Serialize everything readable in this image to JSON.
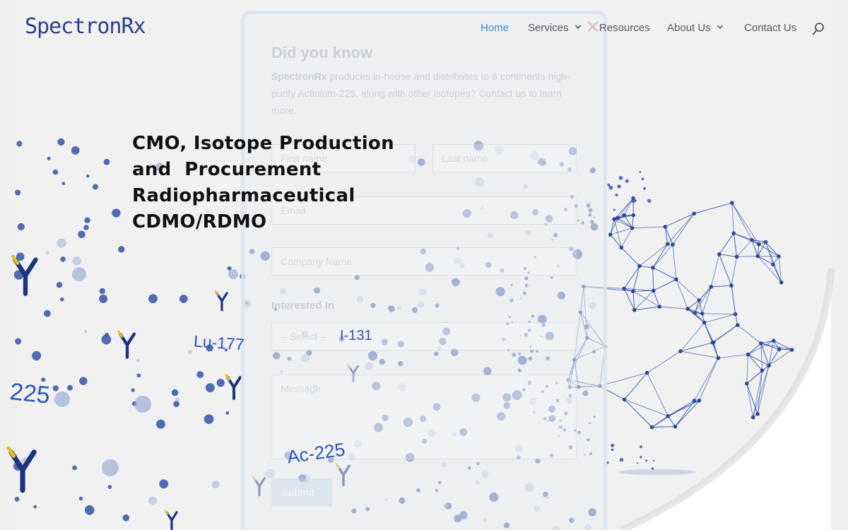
{
  "brand": {
    "logo_text": "SpectronRx",
    "color": "#2c3f8f"
  },
  "nav": {
    "items": [
      {
        "label": "Home",
        "active": true,
        "has_dropdown": false
      },
      {
        "label": "Services",
        "active": false,
        "has_dropdown": true
      },
      {
        "label": "Resources",
        "active": false,
        "has_dropdown": false
      },
      {
        "label": "About Us",
        "active": false,
        "has_dropdown": true
      },
      {
        "label": "Contact Us",
        "active": false,
        "has_dropdown": false
      }
    ],
    "search_icon": "search-icon",
    "active_color": "#3d8fd1",
    "text_color": "#555a60"
  },
  "hero": {
    "heading_lines": [
      "CMO, Isotope Production",
      "and  Procurement",
      "Radiopharmaceutical",
      "CDMO/RDMO"
    ],
    "isotope_labels": [
      "Lu-177",
      "I-131",
      "Ac-225",
      "225"
    ]
  },
  "popup": {
    "title": "Did you know",
    "text_bold": "SpectronRx",
    "text_rest": " produces in-house and distributes to 6 continents high-purity Actinium-225, along with other isotopes? Contact us to learn more.",
    "first_name_placeholder": "First name",
    "last_name_placeholder": "Last name",
    "email_placeholder": "Email",
    "company_placeholder": "Company Name",
    "interest_label": "Interested In",
    "interest_select": "-- Select --",
    "message_placeholder": "Message",
    "submit_label": "Submit"
  }
}
